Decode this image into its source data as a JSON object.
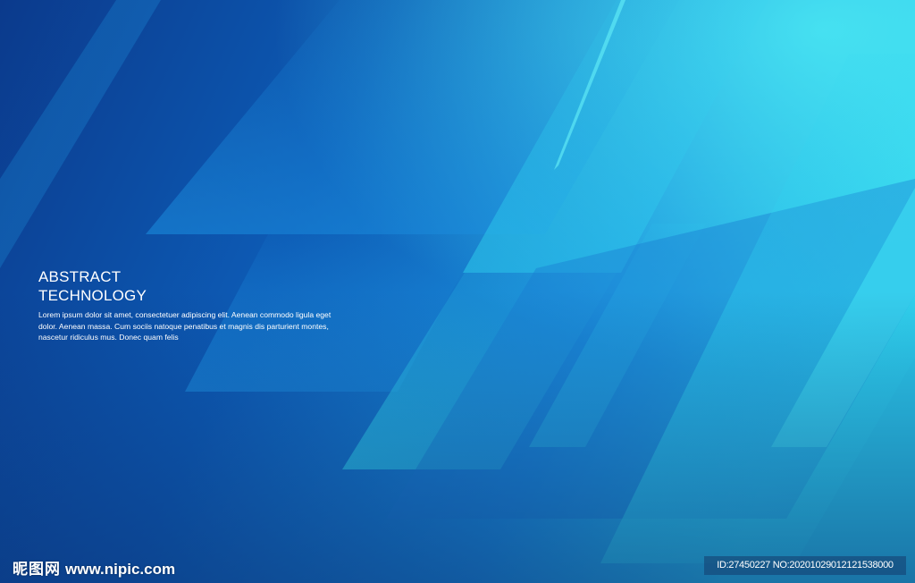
{
  "heading": {
    "line1": "ABSTRACT",
    "line2": "TECHNOLOGY"
  },
  "body": "Lorem ipsum dolor sit amet, consectetuer adipiscing elit. Aenean commodo ligula eget dolor. Aenean massa. Cum sociis natoque penatibus et magnis dis parturient montes, nascetur ridiculus mus. Donec quam felis",
  "watermark": {
    "cn": "昵图网",
    "url": "www.nipic.com"
  },
  "id_badge": "ID:27450227 NO:20201029012121538000",
  "colors": {
    "dark": "#0a2f7a",
    "mid": "#1170c8",
    "light": "#2fd6ee"
  }
}
